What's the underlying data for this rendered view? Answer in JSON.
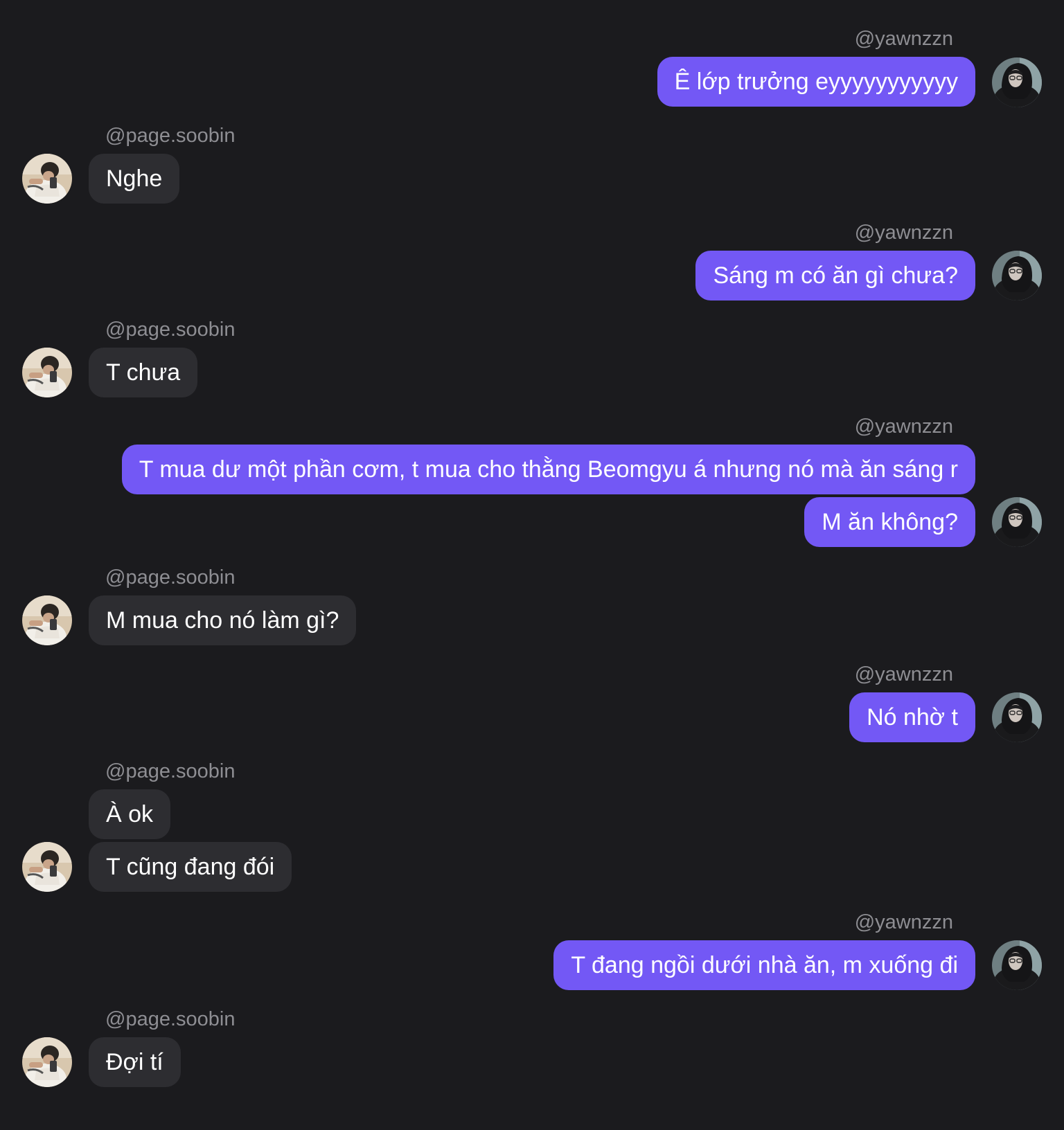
{
  "participants": {
    "me": {
      "handle": "@yawnzzn",
      "avatar_icon": "profile-photo-dark-hood"
    },
    "them": {
      "handle": "@page.soobin",
      "avatar_icon": "profile-photo-light"
    }
  },
  "colors": {
    "background": "#1b1b1e",
    "sent_bubble": "#7358f5",
    "received_bubble": "#2d2d31",
    "username": "#8e8e93",
    "text": "#ffffff"
  },
  "messages": [
    {
      "from": "me",
      "text": "Ê lớp trưởng eyyyyyyyyyyy"
    },
    {
      "from": "them",
      "text": "Nghe"
    },
    {
      "from": "me",
      "text": "Sáng m có ăn gì chưa?"
    },
    {
      "from": "them",
      "text": "T chưa"
    },
    {
      "from": "me",
      "text": "T mua dư một phần cơm, t mua cho thằng Beomgyu á nhưng nó mà ăn sáng r"
    },
    {
      "from": "me",
      "text": "M ăn không?"
    },
    {
      "from": "them",
      "text": "M mua cho nó làm gì?"
    },
    {
      "from": "me",
      "text": "Nó nhờ t"
    },
    {
      "from": "them",
      "text": "À ok"
    },
    {
      "from": "them",
      "text": "T cũng đang đói"
    },
    {
      "from": "me",
      "text": "T đang ngồi dưới nhà ăn, m xuống đi"
    },
    {
      "from": "them",
      "text": "Đợi tí"
    }
  ]
}
